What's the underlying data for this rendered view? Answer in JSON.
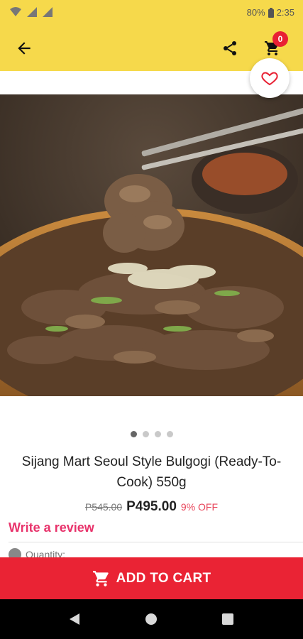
{
  "status_bar": {
    "battery": "80%",
    "time": "2:35"
  },
  "app_bar": {
    "cart_count": "0"
  },
  "gallery": {
    "total": 4,
    "active": 0
  },
  "product": {
    "title": "Sijang Mart Seoul Style Bulgogi (Ready-To-Cook) 550g",
    "old_price": "P545.00",
    "price": "P495.00",
    "discount": "9% OFF"
  },
  "actions": {
    "write_review": "Write a review",
    "quantity_label": "Quantity:",
    "add_to_cart": "ADD TO CART"
  },
  "colors": {
    "appbar": "#f6d94b",
    "accent": "#ea2334",
    "review": "#e8336b"
  },
  "icons": [
    "back-arrow-icon",
    "share-icon",
    "cart-icon",
    "heart-icon",
    "cart-icon"
  ]
}
